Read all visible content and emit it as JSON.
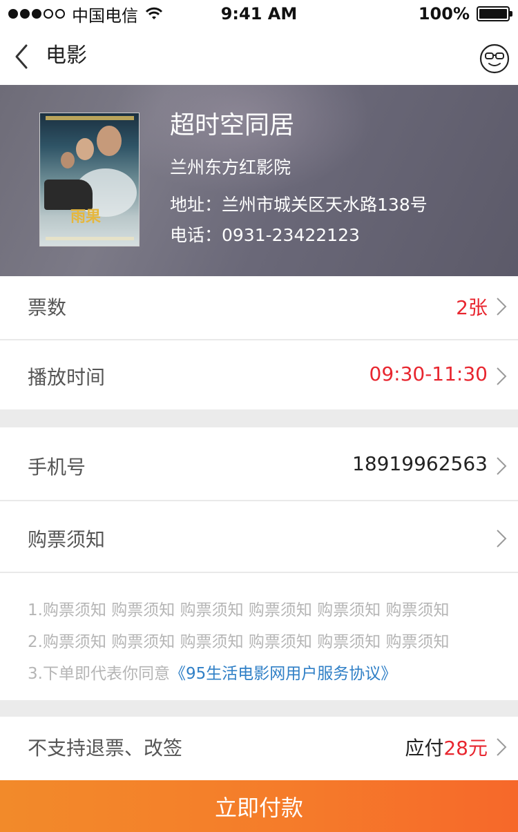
{
  "status_bar": {
    "carrier": "中国电信",
    "time": "9:41 AM",
    "battery": "100%",
    "battery_level": 1.0,
    "signal_bars_filled": 3,
    "signal_bars_total": 5
  },
  "nav": {
    "title": "电影",
    "back_icon": "chevron-left-icon",
    "profile_icon": "sunglasses-face-icon"
  },
  "movie": {
    "title": "超时空同居",
    "cinema": "兰州东方红影院",
    "address": "地址：兰州市城关区天水路138号",
    "phone": "电话：0931-23422123",
    "poster_title": "雨果"
  },
  "tickets": {
    "label": "票数",
    "value": "2张"
  },
  "showtime": {
    "label": "播放时间",
    "value": "09:30-11:30"
  },
  "phone_row": {
    "label": "手机号",
    "value": "18919962563"
  },
  "notice_row": {
    "label": "购票须知"
  },
  "notice_text": {
    "line1": "1.购票须知 购票须知 购票须知 购票须知 购票须知 购票须知",
    "line2": "2.购票须知 购票须知 购票须知 购票须知 购票须知 购票须知",
    "line3_prefix": "3.下单即代表你同意",
    "line3_link": "《95生活电影网用户服务协议》"
  },
  "payment": {
    "refund_notice": "不支持退票、改签",
    "due_label": "应付",
    "due_amount": "28元"
  },
  "pay_button": {
    "label": "立即付款"
  },
  "colors": {
    "accent_red": "#e8262f",
    "link_blue": "#2f7fc6",
    "button_orange": "#f57c2a"
  }
}
